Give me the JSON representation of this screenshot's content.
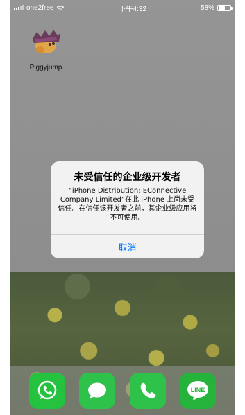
{
  "status_bar": {
    "carrier": "one2free",
    "time": "下午4:32",
    "battery_percent": "58%",
    "battery_level": 0.58
  },
  "home_apps": [
    {
      "label": "Piggyjump",
      "icon": "piggyjump-app-icon"
    }
  ],
  "alert": {
    "title": "未受信任的企业级开发者",
    "message": "“iPhone Distribution: EConnective Company Limited”在此 iPhone 上尚未受信任。在信任该开发者之前，其企业级应用将不可使用。",
    "cancel_label": "取消"
  },
  "dock": {
    "apps": [
      {
        "name": "whatsapp-app-icon",
        "color": "#25c23f"
      },
      {
        "name": "messages-app-icon",
        "color": "#2fc24a"
      },
      {
        "name": "phone-app-icon",
        "color": "#2fc24a"
      },
      {
        "name": "line-app-icon",
        "color": "#25b33c"
      }
    ]
  },
  "colors": {
    "accent": "#0a7aff",
    "dim_overlay": "#8f8f8f"
  }
}
